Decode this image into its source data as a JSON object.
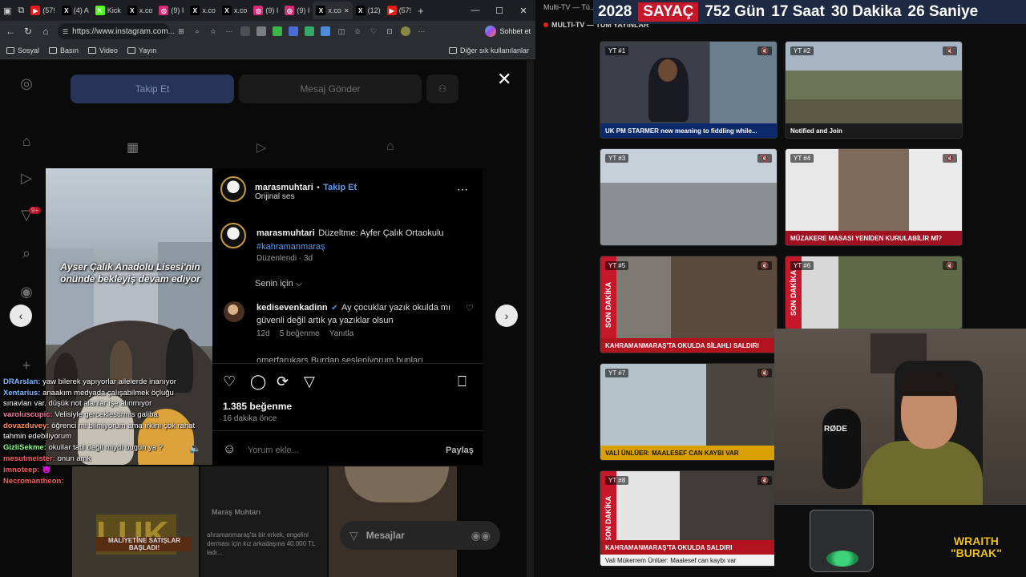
{
  "browser": {
    "tabs": [
      {
        "label": "(57!",
        "color": "#e21b1b",
        "icon": "youtube-icon"
      },
      {
        "label": "(4) A",
        "color": "#000000",
        "icon": "x-icon"
      },
      {
        "label": "Kick",
        "color": "#53fc18",
        "icon": "kick-icon"
      },
      {
        "label": "x.co",
        "color": "#000000",
        "icon": "x-icon"
      },
      {
        "label": "(9) I",
        "color": "#d62976",
        "icon": "instagram-icon"
      },
      {
        "label": "x.co",
        "color": "#000000",
        "icon": "x-icon"
      },
      {
        "label": "x.co",
        "color": "#000000",
        "icon": "x-icon"
      },
      {
        "label": "(9) I",
        "color": "#d62976",
        "icon": "instagram-icon"
      },
      {
        "label": "(9) I",
        "color": "#d62976",
        "icon": "instagram-icon"
      },
      {
        "label": "x.co",
        "color": "#000000",
        "icon": "x-icon"
      },
      {
        "label": "(12)",
        "color": "#000000",
        "icon": "x-icon"
      },
      {
        "label": "(57!",
        "color": "#e21b1b",
        "icon": "youtube-icon"
      }
    ],
    "url": "https://www.instagram.com...",
    "chat_button": "Sohbet et",
    "bookmarks": [
      "Sosyal",
      "Basın",
      "Video",
      "Yayın"
    ],
    "bookmarks_right": "Diğer sık kullanılanlar"
  },
  "profile": {
    "follow": "Takip Et",
    "message": "Mesaj Gönder"
  },
  "post": {
    "media_caption": "Ayser Çalık Anadolu Lisesi'nin önünde bekleyiş devam ediyor",
    "author": "marasmuhtari",
    "follow_link": "Takip Et",
    "dot": "•",
    "audio": "Orijinal ses",
    "caption_user": "marasmuhtari",
    "caption_text": "Düzeltme: Ayfer Çalık Ortaokulu",
    "hashtag": "#kahramanmaraş",
    "edited": "Düzenlendi · 3d",
    "for_you": "Senin için",
    "comment": {
      "user": "kedisevenkadinn",
      "text": "Ay çocuklar yazık okulda mı güvenli değil artık ya yazıklar olsun",
      "age": "12d",
      "likes": "5 beğenme",
      "reply": "Yanıtla"
    },
    "comment2_partial": "omerfarukars Burdan seslepiyorum bunları",
    "likes": "1.385 beğenme",
    "time": "16 dakika önce",
    "comment_placeholder": "Yorum ekle...",
    "share": "Paylaş"
  },
  "chat": [
    {
      "user": "DRArslan:",
      "color": "#7ab8ff",
      "text": "yaw bilerek yapıyorlar ailelerde inanıyor"
    },
    {
      "user": "Xentarius:",
      "color": "#7ab8ff",
      "text": "anaakım medyada çalışabilmek öçluğu sınavları var. düşük not alanlar işe alınmıyor"
    },
    {
      "user": "varoluscupic:",
      "color": "#ff6f9a",
      "text": "Velisiyle gerceklestirmis galiba"
    },
    {
      "user": "dovazduvey:",
      "color": "#ff8a5c",
      "text": "öğrenci mi bilmiyorum ama ırkını çok rahat tahmin edebiliyorum"
    },
    {
      "user": "GizliSekme:",
      "color": "#8bff8b",
      "text": "okullar tatil değil miydi bugün ya ?"
    },
    {
      "user": "mesutmeister:",
      "color": "#ff5b5b",
      "text": "onun amk"
    },
    {
      "user": "imnoteep:",
      "color": "#ff5b5b",
      "text": "😈"
    },
    {
      "user": "Necromantheon:",
      "color": "#ff5b5b",
      "text": ""
    }
  ],
  "bottom": {
    "thumb2_title": "Maraş Muhtarı",
    "thumb2_text": "ahramanmaraş'ta bir erkek, engelini derması için kız arkadaşına 40.000 TL ladı...",
    "thumb1_text": "MALİYETİNE SATIŞLAR BAŞLADI!",
    "messages": "Mesajlar",
    "badge": "9+"
  },
  "stream": {
    "window_title": "Multi-TV — Tü...",
    "subtitle": "MULTI-TV — TÜM YAYINLAR",
    "banner": {
      "year": "2028",
      "label": "SAYAÇ",
      "days": "752 Gün",
      "hours": "17 Saat",
      "minutes": "30 Dakika",
      "seconds": "26 Saniye"
    },
    "tiles": [
      {
        "label": "YT #1",
        "ticker": "UK PM STARMER new meaning to fiddling while...",
        "tickerColor": "#0c2a6b"
      },
      {
        "label": "YT #2",
        "ticker": "Notified and Join",
        "tickerColor": "#1a1a1a"
      },
      {
        "label": "YT #3",
        "ticker": "",
        "tickerColor": "#1a1a1a"
      },
      {
        "label": "YT #4",
        "ticker": "MÜZAKERE MASASI YENİDEN KURULABİLİR Mİ?",
        "tickerColor": "#a01020"
      },
      {
        "label": "YT #5",
        "ticker": "KAHRAMANMARAŞ'TA OKULDA SİLAHLI SALDIRI",
        "tickerColor": "#b3121f"
      },
      {
        "label": "YT #6",
        "ticker": "",
        "tickerColor": "#1a1a1a"
      },
      {
        "label": "YT #7",
        "ticker": "VALİ ÜNLÜER: MAALESEF CAN KAYBI VAR",
        "tickerColor": "#d8a000"
      },
      {
        "label": "YT #8",
        "ticker": "KAHRAMANMARAŞ'TA OKULDA SALDIRI",
        "tickerColor": "#b3121f"
      }
    ],
    "son_dakika": "SON DAKİKA",
    "sub_ticker": "Vali Mükerrem Ünlüer: Maalesef can kaybı var",
    "brand_line1": "WRAITH",
    "brand_line2": "\"BURAK\"",
    "mic_brand": "RØDE"
  }
}
